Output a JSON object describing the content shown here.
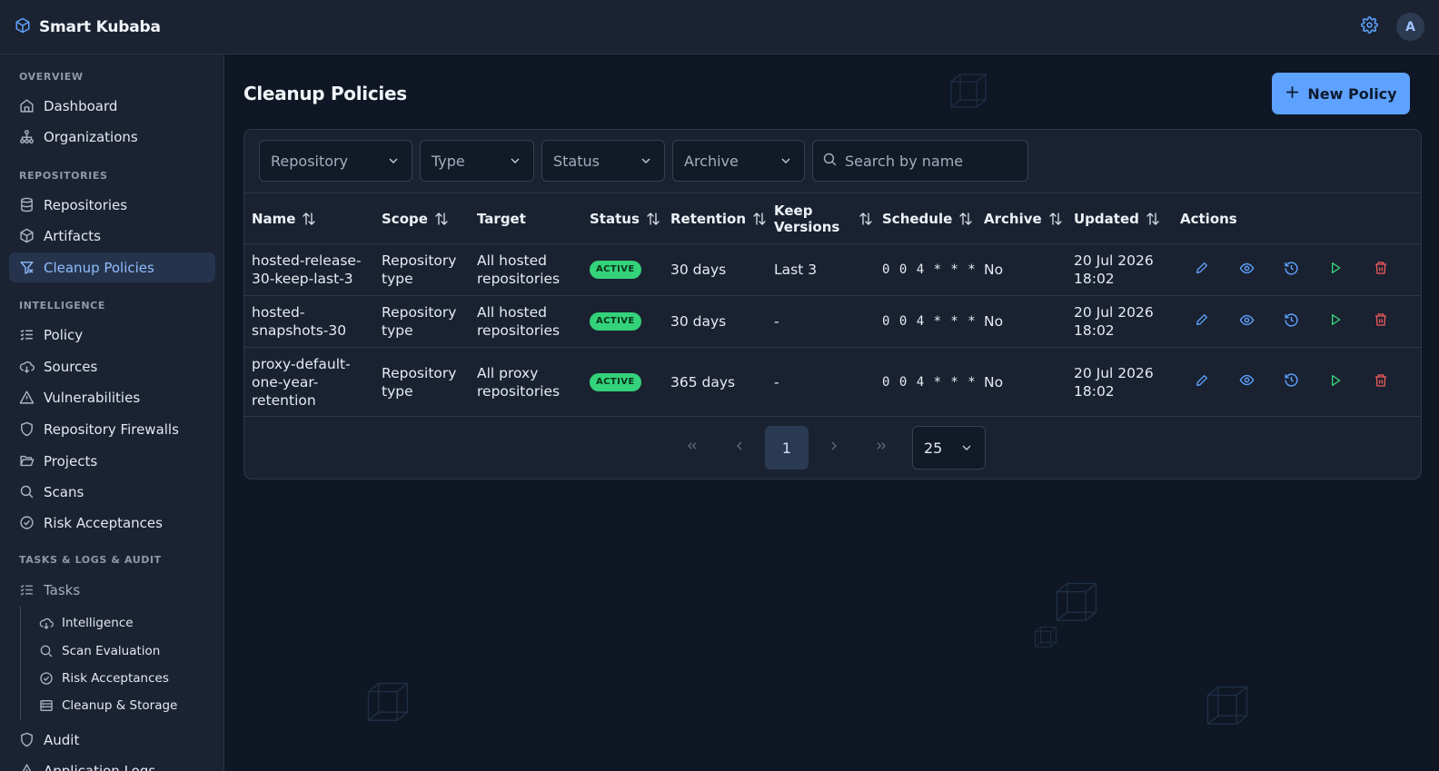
{
  "app": {
    "name": "Smart Kubaba",
    "user_initial": "A"
  },
  "sidebar": {
    "sections": {
      "overview": "OVERVIEW",
      "repositories": "REPOSITORIES",
      "intelligence": "INTELLIGENCE",
      "tasks": "TASKS & LOGS & AUDIT"
    },
    "items": {
      "dashboard": "Dashboard",
      "organizations": "Organizations",
      "repositories": "Repositories",
      "artifacts": "Artifacts",
      "cleanup": "Cleanup Policies",
      "policy": "Policy",
      "sources": "Sources",
      "vulnerabilities": "Vulnerabilities",
      "firewalls": "Repository Firewalls",
      "projects": "Projects",
      "scans": "Scans",
      "risk": "Risk Acceptances",
      "tasks": "Tasks",
      "audit": "Audit",
      "applogs": "Application Logs"
    },
    "subitems": {
      "intelligence": "Intelligence",
      "scan_eval": "Scan Evaluation",
      "risk": "Risk Acceptances",
      "cleanup_storage": "Cleanup & Storage"
    },
    "active": "cleanup"
  },
  "page": {
    "title": "Cleanup Policies",
    "new_button": "New Policy"
  },
  "filters": {
    "repository": "Repository",
    "type": "Type",
    "status": "Status",
    "archive": "Archive",
    "search_placeholder": "Search by name"
  },
  "table": {
    "headers": {
      "name": "Name",
      "scope": "Scope",
      "target": "Target",
      "status": "Status",
      "retention": "Retention",
      "keep_versions_1": "Keep",
      "keep_versions_2": "Versions",
      "schedule": "Schedule",
      "archive": "Archive",
      "updated": "Updated",
      "actions": "Actions"
    },
    "rows": [
      {
        "name_lines": [
          "hosted-release-",
          "30-keep-last-3"
        ],
        "scope_lines": [
          "Repository",
          "type"
        ],
        "target_lines": [
          "All hosted",
          "repositories"
        ],
        "status": "ACTIVE",
        "retention": "30 days",
        "keep": "Last 3",
        "schedule": "0 0 4 * * *",
        "archive": "No",
        "updated_lines": [
          "20 Jul 2026",
          "18:02"
        ]
      },
      {
        "name_lines": [
          "hosted-",
          "snapshots-30"
        ],
        "scope_lines": [
          "Repository",
          "type"
        ],
        "target_lines": [
          "All hosted",
          "repositories"
        ],
        "status": "ACTIVE",
        "retention": "30 days",
        "keep": "-",
        "schedule": "0 0 4 * * *",
        "archive": "No",
        "updated_lines": [
          "20 Jul 2026",
          "18:02"
        ]
      },
      {
        "name_lines": [
          "proxy-default-",
          "one-year-",
          "retention"
        ],
        "scope_lines": [
          "Repository",
          "type"
        ],
        "target_lines": [
          "All proxy",
          "repositories"
        ],
        "status": "ACTIVE",
        "retention": "365 days",
        "keep": "-",
        "schedule": "0 0 4 * * *",
        "archive": "No",
        "updated_lines": [
          "20 Jul 2026",
          "18:02"
        ]
      }
    ]
  },
  "pagination": {
    "current_page": "1",
    "per_page": "25"
  },
  "colors": {
    "accent": "#5ea2ff",
    "active_badge": "#34d27a",
    "delete": "#f05a5a",
    "run": "#37d67a"
  }
}
